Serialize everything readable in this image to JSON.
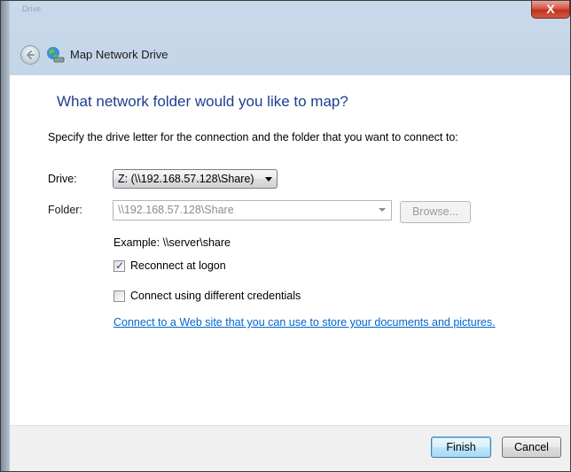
{
  "window": {
    "faded_title": "Drive",
    "close_glyph": "X"
  },
  "nav": {
    "back_icon": "back-arrow-icon",
    "app_icon": "network-drive-icon",
    "title": "Map Network Drive"
  },
  "main": {
    "heading": "What network folder would you like to map?",
    "instruction": "Specify the drive letter for the connection and the folder that you want to connect to:",
    "drive_label": "Drive:",
    "drive_value": "Z: (\\\\192.168.57.128\\Share)",
    "folder_label": "Folder:",
    "folder_value": "\\\\192.168.57.128\\Share",
    "browse_label": "Browse...",
    "example": "Example: \\\\server\\share",
    "reconnect_label": "Reconnect at logon",
    "reconnect_checked": true,
    "credentials_label": "Connect using different credentials",
    "credentials_checked": false,
    "web_link": "Connect to a Web site that you can use to store your documents and pictures."
  },
  "footer": {
    "finish_label": "Finish",
    "cancel_label": "Cancel"
  },
  "colors": {
    "heading": "#1e3e8f",
    "link": "#0066cc",
    "close_button": "#c2321f",
    "chrome": "#bccfe3"
  }
}
